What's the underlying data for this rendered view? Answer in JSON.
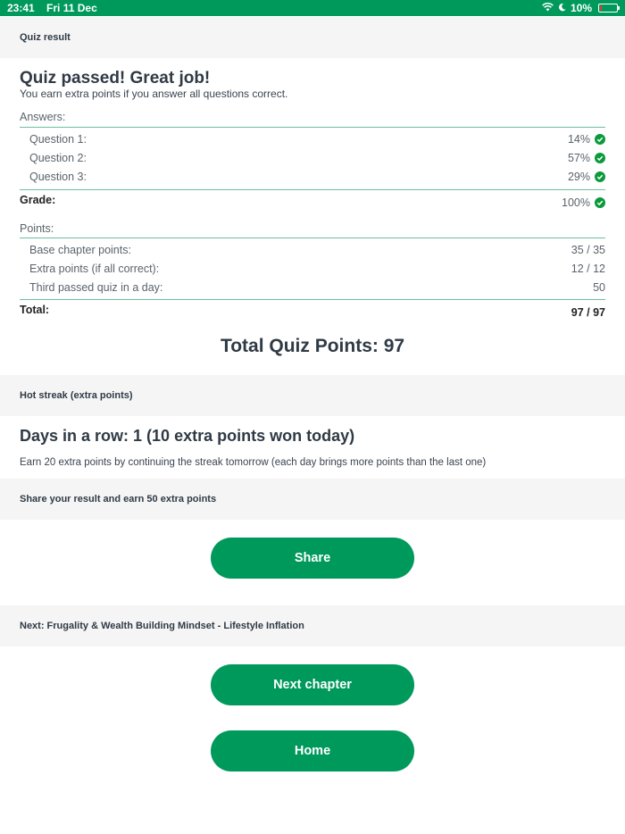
{
  "status_bar": {
    "time": "23:41",
    "date": "Fri 11 Dec",
    "battery": "10%",
    "battery_level": 0.1
  },
  "quiz_result": {
    "section_title": "Quiz result",
    "headline": "Quiz passed! Great job!",
    "subtitle": "You earn extra points if you answer all questions correct.",
    "answers_label": "Answers:",
    "answers": [
      {
        "label": "Question 1:",
        "value": "14%"
      },
      {
        "label": "Question 2:",
        "value": "57%"
      },
      {
        "label": "Question 3:",
        "value": "29%"
      }
    ],
    "grade_label": "Grade:",
    "grade_value": "100%",
    "points_label": "Points:",
    "points": [
      {
        "label": "Base chapter points:",
        "value": "35 / 35"
      },
      {
        "label": "Extra points (if all correct):",
        "value": "12 / 12"
      },
      {
        "label": "Third passed quiz in a day:",
        "value": "50"
      }
    ],
    "total_label": "Total:",
    "total_value": "97 / 97",
    "total_quiz_points": "Total Quiz Points: 97"
  },
  "hot_streak": {
    "section_title": "Hot streak (extra points)",
    "headline": "Days in a row: 1 (10 extra points won today)",
    "description": "Earn 20 extra points by continuing the streak tomorrow (each day brings more points than the last one)"
  },
  "share": {
    "section_title": "Share your result and earn 50 extra points",
    "button_label": "Share"
  },
  "next": {
    "section_title": "Next: Frugality & Wealth Building Mindset - Lifestyle Inflation",
    "next_button_label": "Next chapter",
    "home_button_label": "Home"
  },
  "colors": {
    "accent": "#00995c",
    "check": "#0a9a3c",
    "divider": "#6bbfa0",
    "section_bg": "#f5f5f5"
  }
}
